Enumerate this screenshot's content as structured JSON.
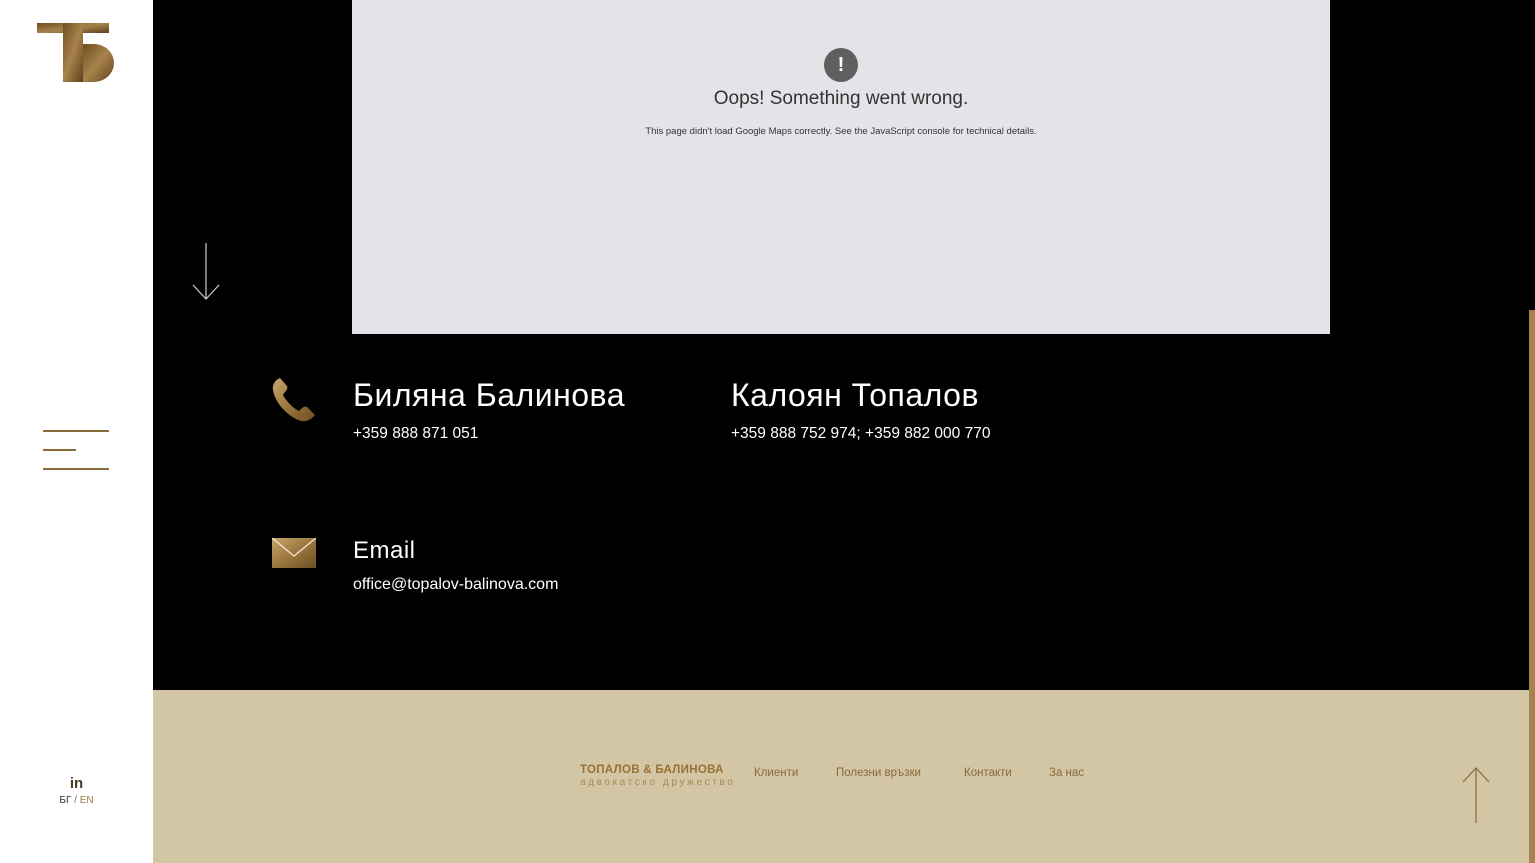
{
  "sidebar": {
    "logo_name": "tb-monogram-logo",
    "social_label": "in",
    "lang": {
      "bg": "БГ",
      "separator": "/",
      "en": "EN"
    }
  },
  "map": {
    "error_title": "Oops! Something went wrong.",
    "error_text": "This page didn't load Google Maps correctly. See the JavaScript console for technical details.",
    "error_icon": "!"
  },
  "contacts": {
    "person1": {
      "name": "Биляна Балинова",
      "phone": "+359 888 871 051"
    },
    "person2": {
      "name": "Калоян Топалов",
      "phone": "+359 888 752 974; +359 882 000 770"
    },
    "email": {
      "label": "Email",
      "address": "office@topalov-balinova.com"
    }
  },
  "footer": {
    "brand_line1": "ТОПАЛОВ & БАЛИНОВА",
    "brand_line2": "адвокатско дружество",
    "nav": [
      "Клиенти",
      "Полезни връзки",
      "Контакти",
      "За нас"
    ]
  },
  "colors": {
    "gold": "#9a7132",
    "footer_bg": "#d2c6a5",
    "map_bg": "#e2e4e8"
  }
}
